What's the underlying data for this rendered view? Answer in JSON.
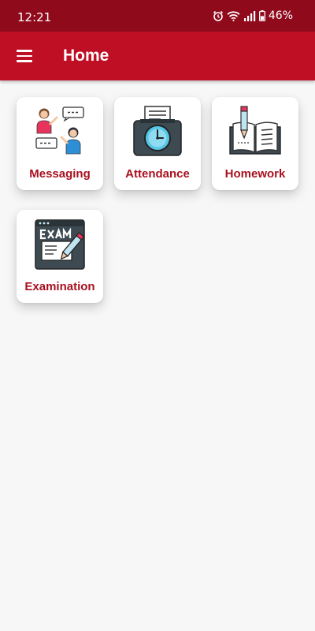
{
  "status_bar": {
    "time": "12:21",
    "battery": "46%",
    "icons": [
      "alarm-icon",
      "wifi-icon",
      "signal-icon",
      "battery-icon"
    ]
  },
  "app_bar": {
    "title": "Home",
    "menu_icon": "hamburger-menu-icon",
    "background": "#bf0f24"
  },
  "colors": {
    "status_bar": "#8f0b1c",
    "accent": "#bf0f24",
    "tile_label": "#a8101f",
    "page_background": "#f7f7f7"
  },
  "tiles": [
    {
      "label": "Messaging",
      "icon": "messaging-icon"
    },
    {
      "label": "Attendance",
      "icon": "attendance-clock-icon"
    },
    {
      "label": "Homework",
      "icon": "homework-book-icon"
    },
    {
      "label": "Examination",
      "icon": "exam-icon"
    }
  ]
}
